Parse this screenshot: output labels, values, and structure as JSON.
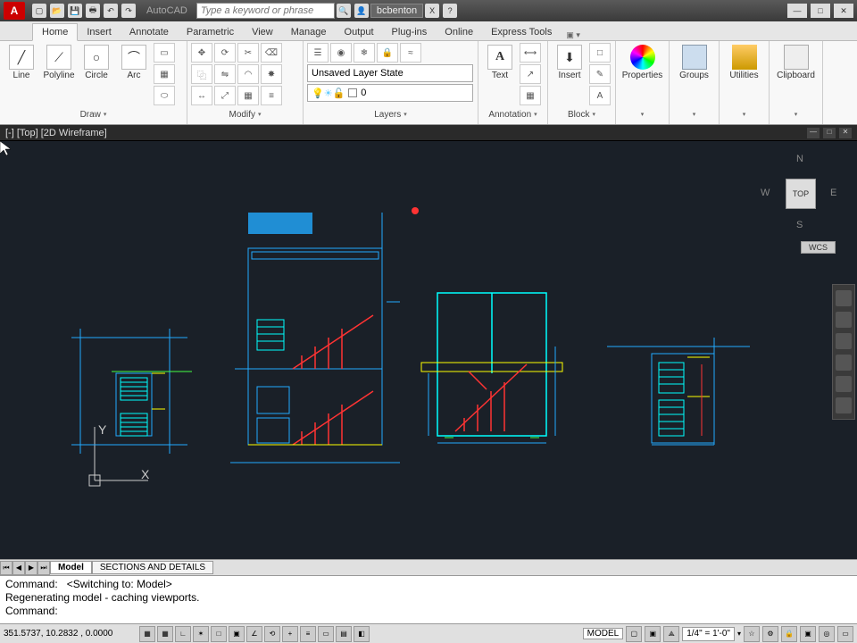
{
  "titlebar": {
    "logo": "A",
    "title": "AutoCAD",
    "search_placeholder": "Type a keyword or phrase",
    "username": "bcbenton"
  },
  "ribbon_tabs": [
    "Home",
    "Insert",
    "Annotate",
    "Parametric",
    "View",
    "Manage",
    "Output",
    "Plug-ins",
    "Online",
    "Express Tools"
  ],
  "ribbon_active": "Home",
  "panels": {
    "draw": {
      "label": "Draw",
      "items": [
        "Line",
        "Polyline",
        "Circle",
        "Arc"
      ]
    },
    "modify": {
      "label": "Modify"
    },
    "layers": {
      "label": "Layers",
      "state": "Unsaved Layer State",
      "current": "0"
    },
    "annotation": {
      "label": "Annotation",
      "text": "Text"
    },
    "block": {
      "label": "Block",
      "insert": "Insert"
    },
    "properties": {
      "label": "Properties"
    },
    "groups": {
      "label": "Groups"
    },
    "utilities": {
      "label": "Utilities"
    },
    "clipboard": {
      "label": "Clipboard"
    }
  },
  "viewport": {
    "label": "[-] [Top] [2D Wireframe]",
    "viewcube": {
      "face": "TOP",
      "n": "N",
      "s": "S",
      "e": "E",
      "w": "W"
    },
    "wcs": "WCS",
    "ucs": {
      "x": "X",
      "y": "Y"
    }
  },
  "layout_tabs": {
    "active": "Model",
    "tabs": [
      "Model",
      "SECTIONS AND DETAILS"
    ]
  },
  "commandline": {
    "line1": "Command:   <Switching to: Model>",
    "line2": "Regenerating model - caching viewports.",
    "line3": "",
    "prompt": "Command:"
  },
  "statusbar": {
    "coords": "351.5737, 10.2832 , 0.0000",
    "model": "MODEL",
    "scale": "1/4\" = 1'-0\""
  }
}
